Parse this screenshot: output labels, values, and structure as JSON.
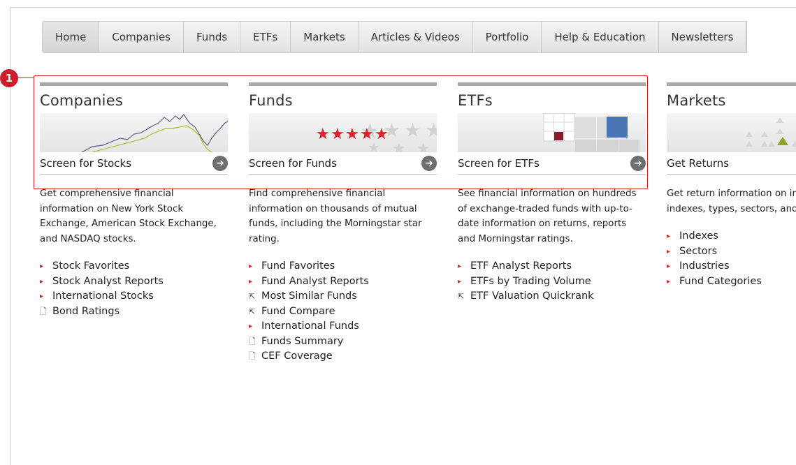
{
  "nav": {
    "tabs": [
      "Home",
      "Companies",
      "Funds",
      "ETFs",
      "Markets",
      "Articles & Videos",
      "Portfolio",
      "Help & Education",
      "Newsletters"
    ],
    "active": "Home"
  },
  "callout": {
    "number": "1",
    "color": "#cc1f2b"
  },
  "columns": [
    {
      "title": "Companies",
      "cta": "Screen for Stocks",
      "desc": "Get comprehensive financial information on New York Stock Exchange, American Stock Exchange, and NASDAQ stocks.",
      "links": [
        {
          "icon": "arrow",
          "label": "Stock Favorites"
        },
        {
          "icon": "arrow",
          "label": "Stock Analyst Reports"
        },
        {
          "icon": "arrow",
          "label": "International Stocks"
        },
        {
          "icon": "doc",
          "label": "Bond Ratings"
        }
      ]
    },
    {
      "title": "Funds",
      "cta": "Screen for Funds",
      "desc": "Find comprehensive financial information on thousands of mutual funds, including the Morningstar star rating.",
      "links": [
        {
          "icon": "arrow",
          "label": "Fund Favorites"
        },
        {
          "icon": "arrow",
          "label": "Fund Analyst Reports"
        },
        {
          "icon": "quick",
          "label": "Most Similar Funds"
        },
        {
          "icon": "quick",
          "label": "Fund Compare"
        },
        {
          "icon": "arrow",
          "label": "International Funds"
        },
        {
          "icon": "doc",
          "label": "Funds Summary"
        },
        {
          "icon": "doc",
          "label": "CEF Coverage"
        }
      ]
    },
    {
      "title": "ETFs",
      "cta": "Screen for ETFs",
      "desc": "See financial information on hundreds of exchange-traded funds with up-to-date information on returns, reports and Morningstar ratings.",
      "links": [
        {
          "icon": "arrow",
          "label": "ETF Analyst Reports"
        },
        {
          "icon": "arrow",
          "label": "ETFs by Trading Volume"
        },
        {
          "icon": "quick",
          "label": "ETF Valuation Quickrank"
        }
      ]
    },
    {
      "title": "Markets",
      "cta": "Get Returns",
      "desc": "Get return information on investment indexes, types, sectors, and styles.",
      "links": [
        {
          "icon": "arrow",
          "label": "Indexes"
        },
        {
          "icon": "arrow",
          "label": "Sectors"
        },
        {
          "icon": "arrow",
          "label": "Industries"
        },
        {
          "icon": "arrow",
          "label": "Fund Categories"
        }
      ]
    }
  ],
  "icons": {
    "arrow": "▸",
    "doc": "🗋",
    "quick": "⇱",
    "cta": "➔"
  },
  "colors": {
    "accent_red": "#cc1f2b",
    "star_red": "#e0202a",
    "bar_gray": "#a9a9a9",
    "etf_blue": "#4a74b4",
    "market_green": "#8aa62a"
  }
}
